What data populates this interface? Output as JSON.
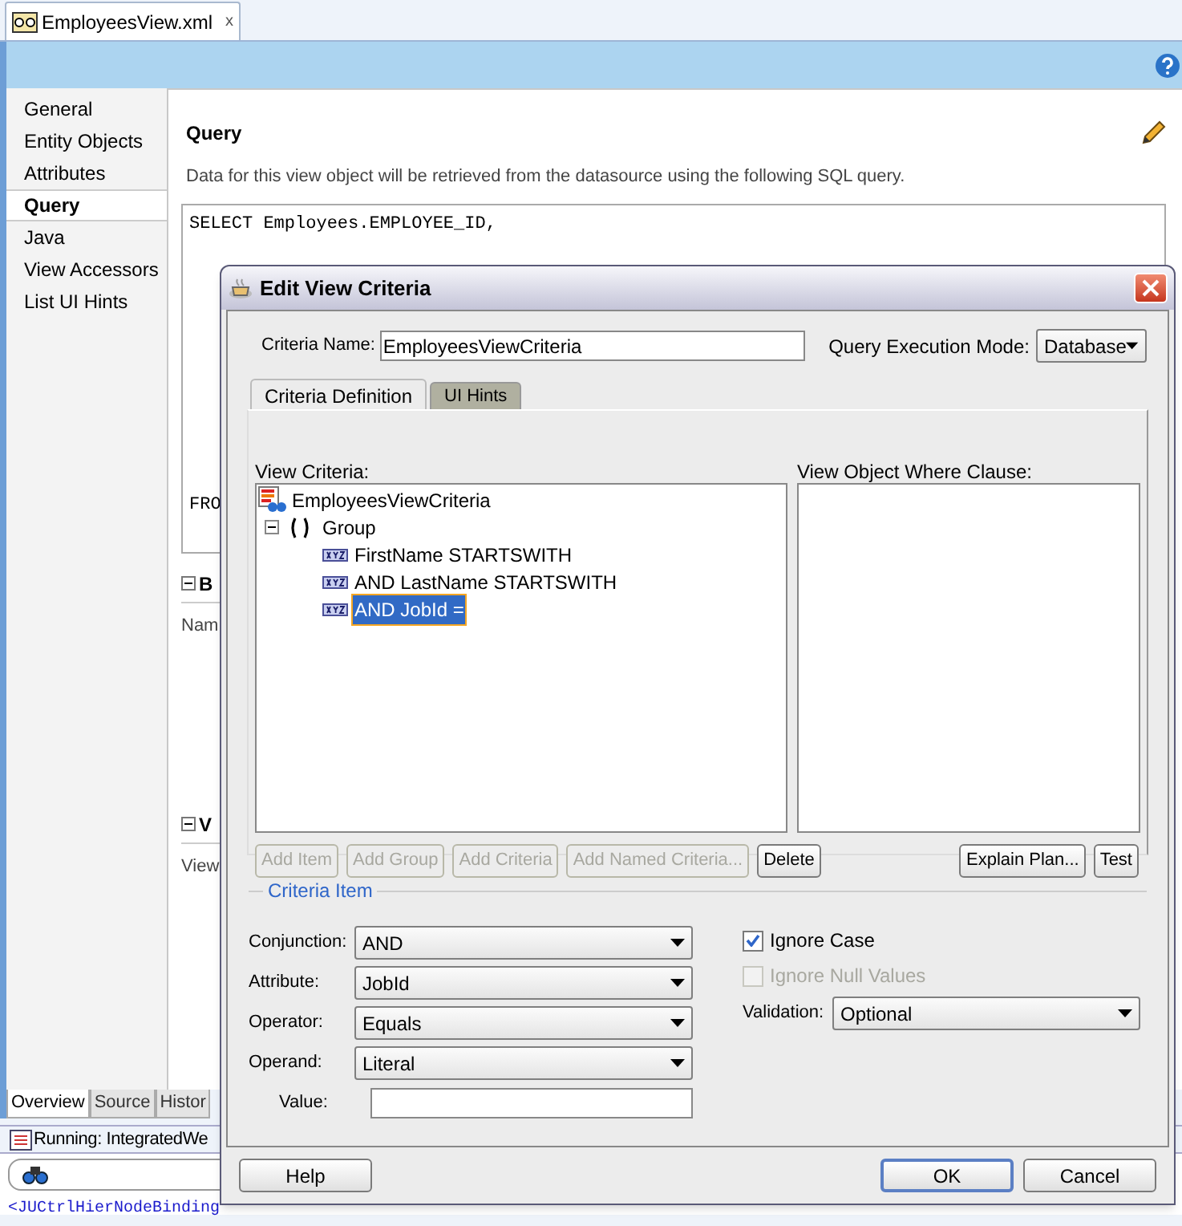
{
  "editor_tab": {
    "title": "EmployeesView.xml",
    "close": "x"
  },
  "sidebar": {
    "items": [
      {
        "label": "General",
        "selected": false
      },
      {
        "label": "Entity Objects",
        "selected": false
      },
      {
        "label": "Attributes",
        "selected": false
      },
      {
        "label": "Query",
        "selected": true
      },
      {
        "label": "Java",
        "selected": false
      },
      {
        "label": "View Accessors",
        "selected": false
      },
      {
        "label": "List UI Hints",
        "selected": false
      }
    ]
  },
  "query": {
    "heading": "Query",
    "description": "Data for this view object will be retrieved from the datasource using the following SQL query.",
    "sql_first_line": "SELECT Employees.EMPLOYEE_ID,",
    "sql_cut_line": "FRO"
  },
  "sections": [
    {
      "title": "B",
      "fragment": "Nam"
    },
    {
      "title": "V",
      "fragment": "View"
    }
  ],
  "bottom_tabs": [
    {
      "label": "Overview",
      "selected": true
    },
    {
      "label": "Source",
      "selected": false
    },
    {
      "label": "Histor",
      "selected": false
    }
  ],
  "log": {
    "status": "Running: IntegratedWe",
    "line": "<JUCtrlHierNodeBinding"
  },
  "dialog": {
    "title": "Edit View Criteria",
    "criteria_name_label": "Criteria Name:",
    "criteria_name": "EmployeesViewCriteria",
    "mode_label": "Query Execution Mode:",
    "mode": "Database",
    "tabs": [
      {
        "label": "Criteria Definition",
        "selected": true
      },
      {
        "label": "UI Hints",
        "selected": false
      }
    ],
    "view_criteria_label": "View Criteria:",
    "tree": {
      "label": "EmployeesViewCriteria",
      "selected": false,
      "children": [
        {
          "label": "Group",
          "expanded": true,
          "selected": false,
          "children": [
            {
              "label": "FirstName STARTSWITH",
              "selected": false
            },
            {
              "label": "AND LastName STARTSWITH",
              "selected": false
            },
            {
              "label": "AND JobId =",
              "selected": true
            }
          ]
        }
      ]
    },
    "where_label": "View Object Where Clause:",
    "left_buttons": [
      {
        "label": "Add Item",
        "disabled": true
      },
      {
        "label": "Add Group",
        "disabled": true
      },
      {
        "label": "Add Criteria",
        "disabled": true
      },
      {
        "label": "Add Named Criteria...",
        "disabled": true
      },
      {
        "label": "Delete",
        "disabled": false
      }
    ],
    "right_buttons": [
      {
        "label": "Explain Plan...",
        "disabled": false
      },
      {
        "label": "Test",
        "disabled": false
      }
    ],
    "criteria_item_legend": "Criteria Item",
    "fields": [
      {
        "kind": "select",
        "label": "Conjunction:",
        "value": "AND"
      },
      {
        "kind": "select",
        "label": "Attribute:",
        "value": "JobId"
      },
      {
        "kind": "select",
        "label": "Operator:",
        "value": "Equals"
      },
      {
        "kind": "select",
        "label": "Operand:",
        "value": "Literal"
      },
      {
        "kind": "text",
        "label": "Value:"
      }
    ],
    "options": [
      {
        "label": "Ignore Case",
        "checked": true,
        "disabled": false
      },
      {
        "label": "Ignore Null Values",
        "checked": false,
        "disabled": true
      }
    ],
    "validation": {
      "label": "Validation:",
      "value": "Optional"
    },
    "footer": [
      {
        "label": "Help",
        "default": false
      },
      {
        "label": "OK",
        "default": true
      },
      {
        "label": "Cancel",
        "default": false
      }
    ]
  }
}
